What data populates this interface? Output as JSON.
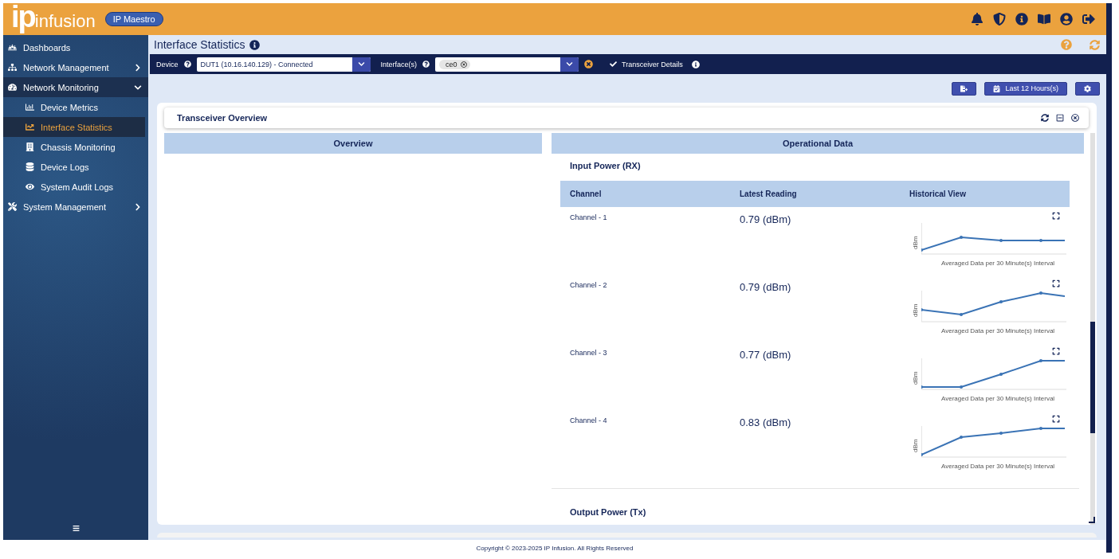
{
  "header": {
    "logo_mark": "ip",
    "logo_word": "infusion",
    "product_badge": "IP Maestro"
  },
  "sidebar": {
    "items": [
      {
        "label": "Dashboards",
        "kind": "link",
        "selected": false
      },
      {
        "label": "Network Management",
        "kind": "group",
        "expanded": false,
        "selected": false
      },
      {
        "label": "Network Monitoring",
        "kind": "group",
        "expanded": true,
        "selected": false,
        "children": [
          {
            "label": "Device Metrics",
            "kind": "link",
            "selected": false
          },
          {
            "label": "Interface Statistics",
            "kind": "link",
            "selected": true
          },
          {
            "label": "Chassis Monitoring",
            "kind": "link",
            "selected": false
          },
          {
            "label": "Device Logs",
            "kind": "link",
            "selected": false
          },
          {
            "label": "System Audit Logs",
            "kind": "link",
            "selected": false
          }
        ]
      },
      {
        "label": "System Management",
        "kind": "group",
        "expanded": false,
        "selected": false
      }
    ]
  },
  "page": {
    "title": "Interface Statistics"
  },
  "filters": {
    "device_label": "Device",
    "device_value": "DUT1 (10.16.140.129) - Connected",
    "interface_label": "Interface(s)",
    "interface_chips": [
      "ce0"
    ],
    "transceiver_details": {
      "label": "Transceiver Details",
      "checked": true
    }
  },
  "toolbar": {
    "time_range": "Last 12 Hours(s)"
  },
  "card": {
    "title": "Transceiver Overview",
    "overview_heading": "Overview",
    "operational_heading": "Operational Data",
    "sections": [
      {
        "title": "Input Power (RX)",
        "columns": [
          "Channel",
          "Latest Reading",
          "Historical View"
        ],
        "rows": [
          {
            "channel": "Channel - 1",
            "reading": "0.79 (dBm)",
            "axis": "dBm",
            "caption": "Averaged Data per 30 Minute(s) Interval"
          },
          {
            "channel": "Channel - 2",
            "reading": "0.79 (dBm)",
            "axis": "dBm",
            "caption": "Averaged Data per 30 Minute(s) Interval"
          },
          {
            "channel": "Channel - 3",
            "reading": "0.77 (dBm)",
            "axis": "dBm",
            "caption": "Averaged Data per 30 Minute(s) Interval"
          },
          {
            "channel": "Channel - 4",
            "reading": "0.83 (dBm)",
            "axis": "dBm",
            "caption": "Averaged Data per 30 Minute(s) Interval"
          }
        ]
      },
      {
        "title": "Output Power (Tx)"
      }
    ]
  },
  "footer": {
    "copyright": "Copyright © 2023-2025 IP Infusion. All Rights Reserved"
  }
}
